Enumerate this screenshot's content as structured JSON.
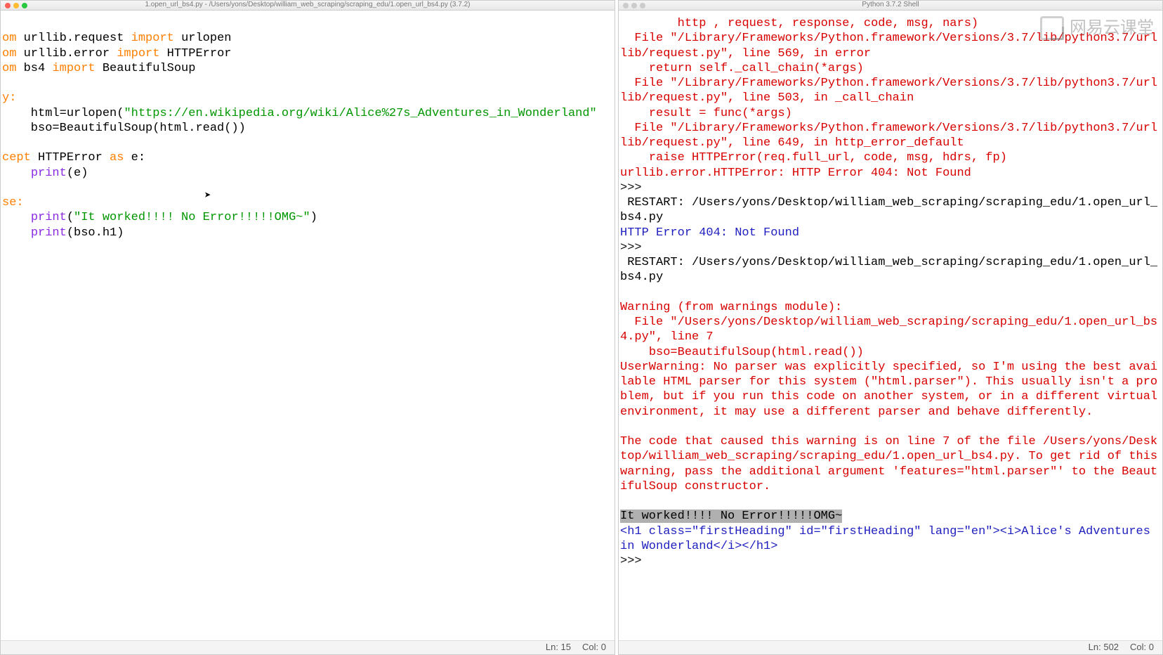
{
  "left": {
    "title": "1.open_url_bs4.py - /Users/yons/Desktop/william_web_scraping/scraping_edu/1.open_url_bs4.py (3.7.2)",
    "code": {
      "l1a": "om ",
      "l1b": "urllib.request ",
      "l1c": "import ",
      "l1d": "urlopen",
      "l2a": "om ",
      "l2b": "urllib.error ",
      "l2c": "import ",
      "l2d": "HTTPError",
      "l3a": "om ",
      "l3b": "bs4 ",
      "l3c": "import ",
      "l3d": "BeautifulSoup",
      "l5": "y:",
      "l6a": "    html=urlopen(",
      "l6b": "\"https://en.wikipedia.org/wiki/Alice%27s_Adventures_in_Wonderland\"",
      "l7": "    bso=BeautifulSoup(html.read())",
      "l9a": "cept ",
      "l9b": "HTTPError ",
      "l9c": "as ",
      "l9d": "e:",
      "l10a": "    ",
      "l10b": "print",
      "l10c": "(e)",
      "l12": "se:",
      "l13a": "    ",
      "l13b": "print",
      "l13c": "(",
      "l13d": "\"It worked!!!! No Error!!!!!OMG~\"",
      "l13e": ")",
      "l14a": "    ",
      "l14b": "print",
      "l14c": "(bso.h1)"
    },
    "status_ln": "Ln: 15",
    "status_col": "Col: 0"
  },
  "right": {
    "title": "Python 3.7.2 Shell",
    "lines": {
      "t0": "        http , request, response, code, msg, nars)",
      "t1": "  File \"/Library/Frameworks/Python.framework/Versions/3.7/lib/python3.7/urllib/request.py\", line 569, in error",
      "t2": "    return self._call_chain(*args)",
      "t3": "  File \"/Library/Frameworks/Python.framework/Versions/3.7/lib/python3.7/urllib/request.py\", line 503, in _call_chain",
      "t4": "    result = func(*args)",
      "t5": "  File \"/Library/Frameworks/Python.framework/Versions/3.7/lib/python3.7/urllib/request.py\", line 649, in http_error_default",
      "t6": "    raise HTTPError(req.full_url, code, msg, hdrs, fp)",
      "t7": "urllib.error.HTTPError: HTTP Error 404: Not Found",
      "p1": ">>> ",
      "r1": " RESTART: /Users/yons/Desktop/william_web_scraping/scraping_edu/1.open_url_bs4.py ",
      "he": "HTTP Error 404: Not Found",
      "p2": ">>> ",
      "r2": " RESTART: /Users/yons/Desktop/william_web_scraping/scraping_edu/1.open_url_bs4.py ",
      "blank": "",
      "w1": "Warning (from warnings module):",
      "w2": "  File \"/Users/yons/Desktop/william_web_scraping/scraping_edu/1.open_url_bs4.py\", line 7",
      "w3": "    bso=BeautifulSoup(html.read())",
      "w4": "UserWarning: No parser was explicitly specified, so I'm using the best available HTML parser for this system (\"html.parser\"). This usually isn't a problem, but if you run this code on another system, or in a different virtual environment, it may use a different parser and behave differently.",
      "w5": "",
      "w6": "The code that caused this warning is on line 7 of the file /Users/yons/Desktop/william_web_scraping/scraping_edu/1.open_url_bs4.py. To get rid of this warning, pass the additional argument 'features=\"html.parser\"' to the BeautifulSoup constructor.",
      "w7": "",
      "ok": "It worked!!!! No Error!!!!!OMG~",
      "h1": "<h1 class=\"firstHeading\" id=\"firstHeading\" lang=\"en\"><i>Alice's Adventures in Wonderland</i></h1>",
      "p3": ">>> "
    },
    "status_ln": "Ln: 502",
    "status_col": "Col: 0"
  },
  "watermark": "网易云课堂"
}
